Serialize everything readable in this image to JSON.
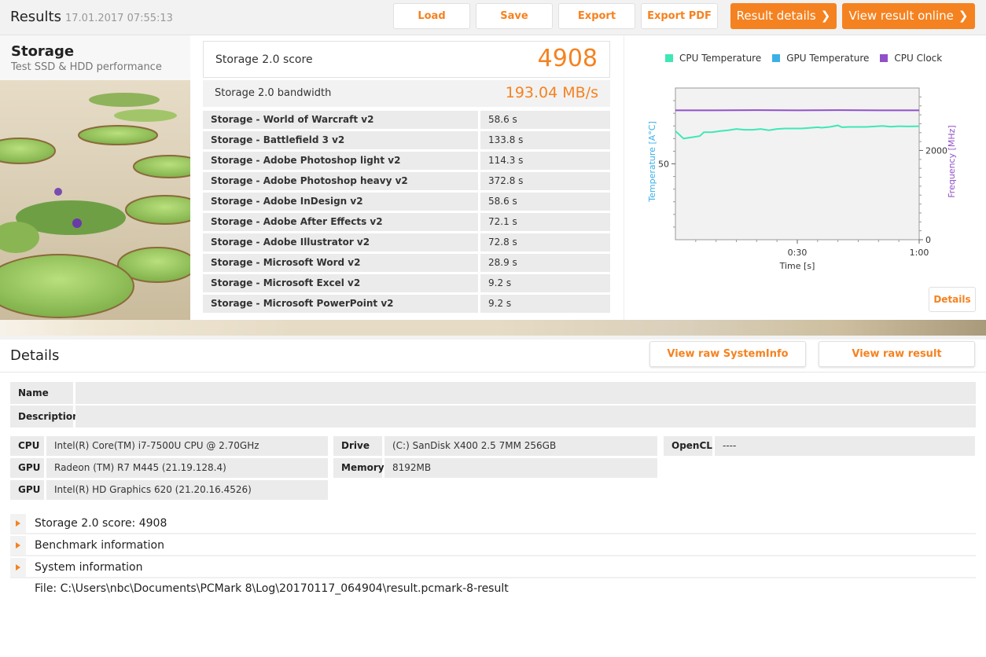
{
  "header": {
    "title": "Results",
    "date": "17.01.2017 07:55:13",
    "buttons": {
      "load": "Load",
      "save": "Save",
      "export": "Export",
      "export_pdf": "Export PDF"
    },
    "result_details": "Result details",
    "view_online": "View result online"
  },
  "test": {
    "title": "Storage",
    "subtitle": "Test SSD & HDD performance"
  },
  "scores": {
    "score_label": "Storage 2.0 score",
    "score_value": "4908",
    "bandwidth_label": "Storage 2.0 bandwidth",
    "bandwidth_value": "193.04 MB/s"
  },
  "results": [
    {
      "name": "Storage - World of Warcraft v2",
      "value": "58.6 s"
    },
    {
      "name": "Storage - Battlefield 3 v2",
      "value": "133.8 s"
    },
    {
      "name": "Storage - Adobe Photoshop light v2",
      "value": "114.3 s"
    },
    {
      "name": "Storage - Adobe Photoshop heavy v2",
      "value": "372.8 s"
    },
    {
      "name": "Storage - Adobe InDesign v2",
      "value": "58.6 s"
    },
    {
      "name": "Storage - Adobe After Effects v2",
      "value": "72.1 s"
    },
    {
      "name": "Storage - Adobe Illustrator v2",
      "value": "72.8 s"
    },
    {
      "name": "Storage - Microsoft Word v2",
      "value": "28.9 s"
    },
    {
      "name": "Storage - Microsoft Excel v2",
      "value": "9.2 s"
    },
    {
      "name": "Storage - Microsoft PowerPoint v2",
      "value": "9.2 s"
    }
  ],
  "chart_data": {
    "type": "line",
    "legend": [
      {
        "name": "CPU Temperature",
        "color": "#3ee8b5"
      },
      {
        "name": "GPU Temperature",
        "color": "#3bb0e8"
      },
      {
        "name": "CPU Clock",
        "color": "#9050c8"
      }
    ],
    "xlabel": "Time [s]",
    "ylabel_left": "Temperature [A°C]",
    "ylabel_right": "Frequency [MHz]",
    "x_ticks": [
      "0:30",
      "1:00"
    ],
    "y_left_ticks": [
      "50"
    ],
    "y_right_ticks": [
      "2000",
      "0"
    ],
    "xlim": [
      0,
      60
    ],
    "y_left_lim": [
      20,
      80
    ],
    "y_right_lim": [
      0,
      3400
    ],
    "series": [
      {
        "name": "CPU Temperature",
        "axis": "left",
        "x": [
          0,
          2,
          4,
          6,
          7,
          9,
          11,
          13,
          15,
          17,
          19,
          21,
          23,
          25,
          27,
          29,
          31,
          33,
          35,
          36,
          38,
          40,
          41,
          43,
          45,
          47,
          49,
          51,
          53,
          55,
          57,
          60
        ],
        "y": [
          63,
          60,
          60.5,
          61,
          62.5,
          62.5,
          63,
          63.3,
          63.8,
          63.5,
          63.5,
          63.8,
          63.3,
          63.8,
          64,
          64,
          64,
          64.2,
          64.5,
          64.3,
          64.6,
          65.2,
          64.5,
          64.6,
          64.6,
          64.6,
          64.8,
          65,
          64.7,
          64.9,
          64.8,
          64.9
        ]
      },
      {
        "name": "CPU Clock",
        "axis": "right",
        "x": [
          0,
          10,
          20,
          30,
          40,
          50,
          60
        ],
        "y": [
          2900,
          2900,
          2905,
          2900,
          2905,
          2900,
          2900
        ]
      }
    ]
  },
  "chart_details_button": "Details",
  "details": {
    "title": "Details",
    "view_systeminfo": "View raw SystemInfo",
    "view_result": "View raw result",
    "name_label": "Name",
    "name_value": "",
    "description_label": "Description",
    "description_value": "",
    "system": {
      "cpu_label": "CPU",
      "cpu_value": "Intel(R) Core(TM) i7-7500U CPU @ 2.70GHz",
      "gpu1_label": "GPU",
      "gpu1_value": "Radeon (TM) R7 M445 (21.19.128.4)",
      "gpu2_label": "GPU",
      "gpu2_value": "Intel(R) HD Graphics 620 (21.20.16.4526)",
      "drive_label": "Drive",
      "drive_value": "(C:) SanDisk X400 2.5 7MM 256GB",
      "memory_label": "Memory",
      "memory_value": "8192MB",
      "opencl_label": "OpenCL",
      "opencl_value": "----"
    },
    "expanders": [
      "Storage 2.0 score: 4908",
      "Benchmark information",
      "System information"
    ],
    "file": "File: C:\\Users\\nbc\\Documents\\PCMark 8\\Log\\20170117_064904\\result.pcmark-8-result"
  },
  "colors": {
    "accent": "#f58220",
    "cpu_temp": "#3ee8b5",
    "gpu_temp": "#3bb0e8",
    "cpu_clock": "#9050c8"
  }
}
